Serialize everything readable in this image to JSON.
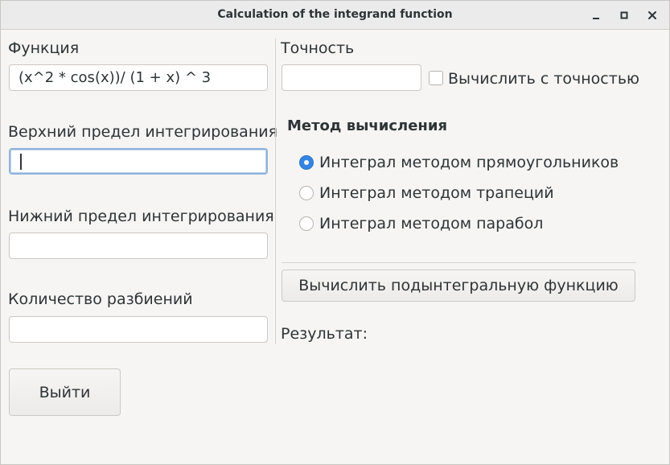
{
  "window": {
    "title": "Calculation of the integrand function",
    "minimize_icon": "minimize-icon",
    "maximize_icon": "maximize-icon",
    "close_icon": "close-icon"
  },
  "left": {
    "function_label": "Функция",
    "function_value": "(x^2 * cos(x))/ (1 + x) ^ 3",
    "upper_label": "Верхний предел интегрирования",
    "upper_value": "",
    "lower_label": "Нижний  предел интегрирования",
    "lower_value": "",
    "partitions_label": "Количество разбиений",
    "partitions_value": "",
    "exit_label": "Выйти"
  },
  "right": {
    "precision_label": "Точность",
    "precision_value": "",
    "precision_check_label": "Вычислить с точностью",
    "precision_checked": false,
    "method_heading": "Метод вычисления",
    "methods": [
      {
        "label": "Интеграл методом прямоугольников",
        "selected": true
      },
      {
        "label": "Интеграл методом трапеций",
        "selected": false
      },
      {
        "label": "Интеграл методом парабол",
        "selected": false
      }
    ],
    "compute_label": "Вычислить подынтегральную функцию",
    "result_label": "Результат:"
  },
  "colors": {
    "accent": "#3584e4",
    "focus_border": "#8fb3dc",
    "background": "#f6f5f4"
  }
}
